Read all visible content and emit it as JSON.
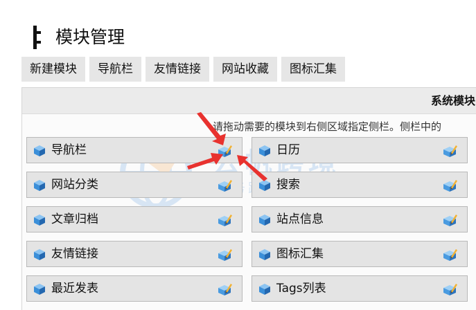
{
  "page": {
    "title": "模块管理"
  },
  "tabs": [
    {
      "label": "新建模块"
    },
    {
      "label": "导航栏"
    },
    {
      "label": "友情链接"
    },
    {
      "label": "网站收藏"
    },
    {
      "label": "图标汇集"
    }
  ],
  "panel": {
    "header": "系统模块",
    "hint": "请拖动需要的模块到右侧区域指定侧栏。侧栏中的"
  },
  "watermark": {
    "main": "云帆跨境",
    "sub": "服务跨境 助力中企出海"
  },
  "modules": {
    "left": [
      {
        "label": "导航栏"
      },
      {
        "label": "网站分类"
      },
      {
        "label": "文章归档"
      },
      {
        "label": "友情链接"
      },
      {
        "label": "最近发表"
      }
    ],
    "right": [
      {
        "label": "日历"
      },
      {
        "label": "搜索"
      },
      {
        "label": "站点信息"
      },
      {
        "label": "图标汇集"
      },
      {
        "label": "Tags列表"
      }
    ]
  },
  "icons": {
    "title": "sidebar-layout-icon",
    "module": "blue-cube-icon",
    "edit": "edit-pencil-box-icon"
  },
  "colors": {
    "tab_bg": "#e6e6e6",
    "module_bg": "#e4e4e4",
    "module_border": "#b9b9b9",
    "cube": "#3b8fd9",
    "annotation_arrow": "#e8322f"
  }
}
